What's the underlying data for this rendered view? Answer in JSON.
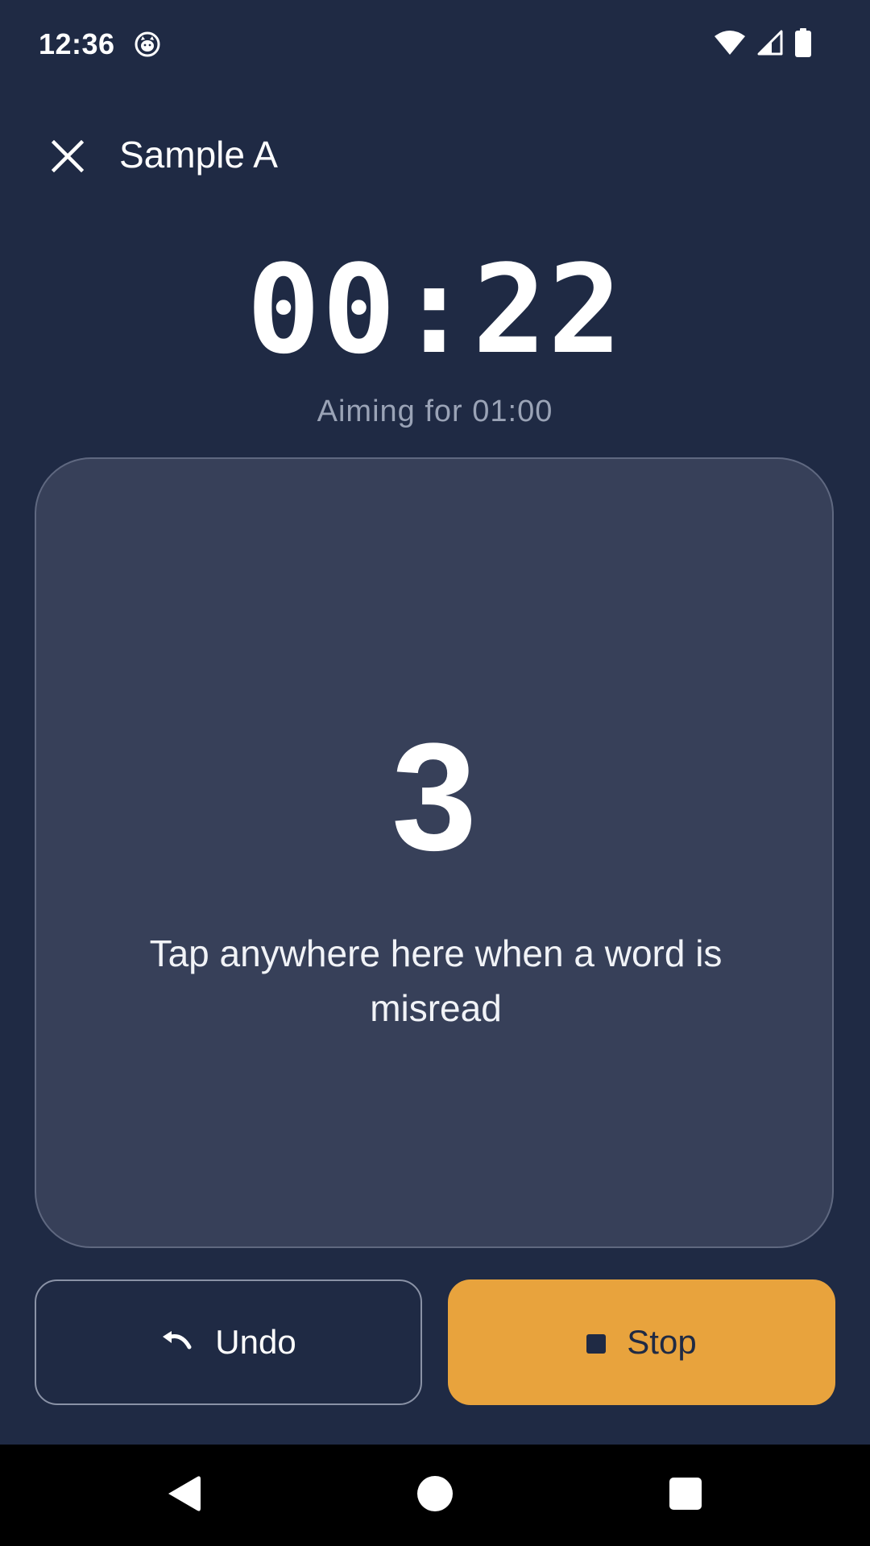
{
  "status_bar": {
    "time": "12:36",
    "icons": [
      "cat-face-notification-icon",
      "wifi-icon",
      "cellular-signal-icon",
      "battery-icon"
    ]
  },
  "top_bar": {
    "close_icon": "close-icon",
    "title": "Sample A"
  },
  "timer": {
    "elapsed": "00:22",
    "target_text": "Aiming for 01:00"
  },
  "tap_area": {
    "count": "3",
    "hint": "Tap anywhere here when a word is misread"
  },
  "actions": {
    "undo_label": "Undo",
    "undo_icon": "undo-arrow-icon",
    "stop_label": "Stop",
    "stop_icon": "stop-square-icon"
  },
  "navigation": {
    "items": [
      "back-icon",
      "home-icon",
      "recents-icon"
    ]
  },
  "colors": {
    "background": "#1f2a44",
    "card": "#374059",
    "accent": "#e8a33d",
    "muted_text": "#9aa3b6"
  }
}
